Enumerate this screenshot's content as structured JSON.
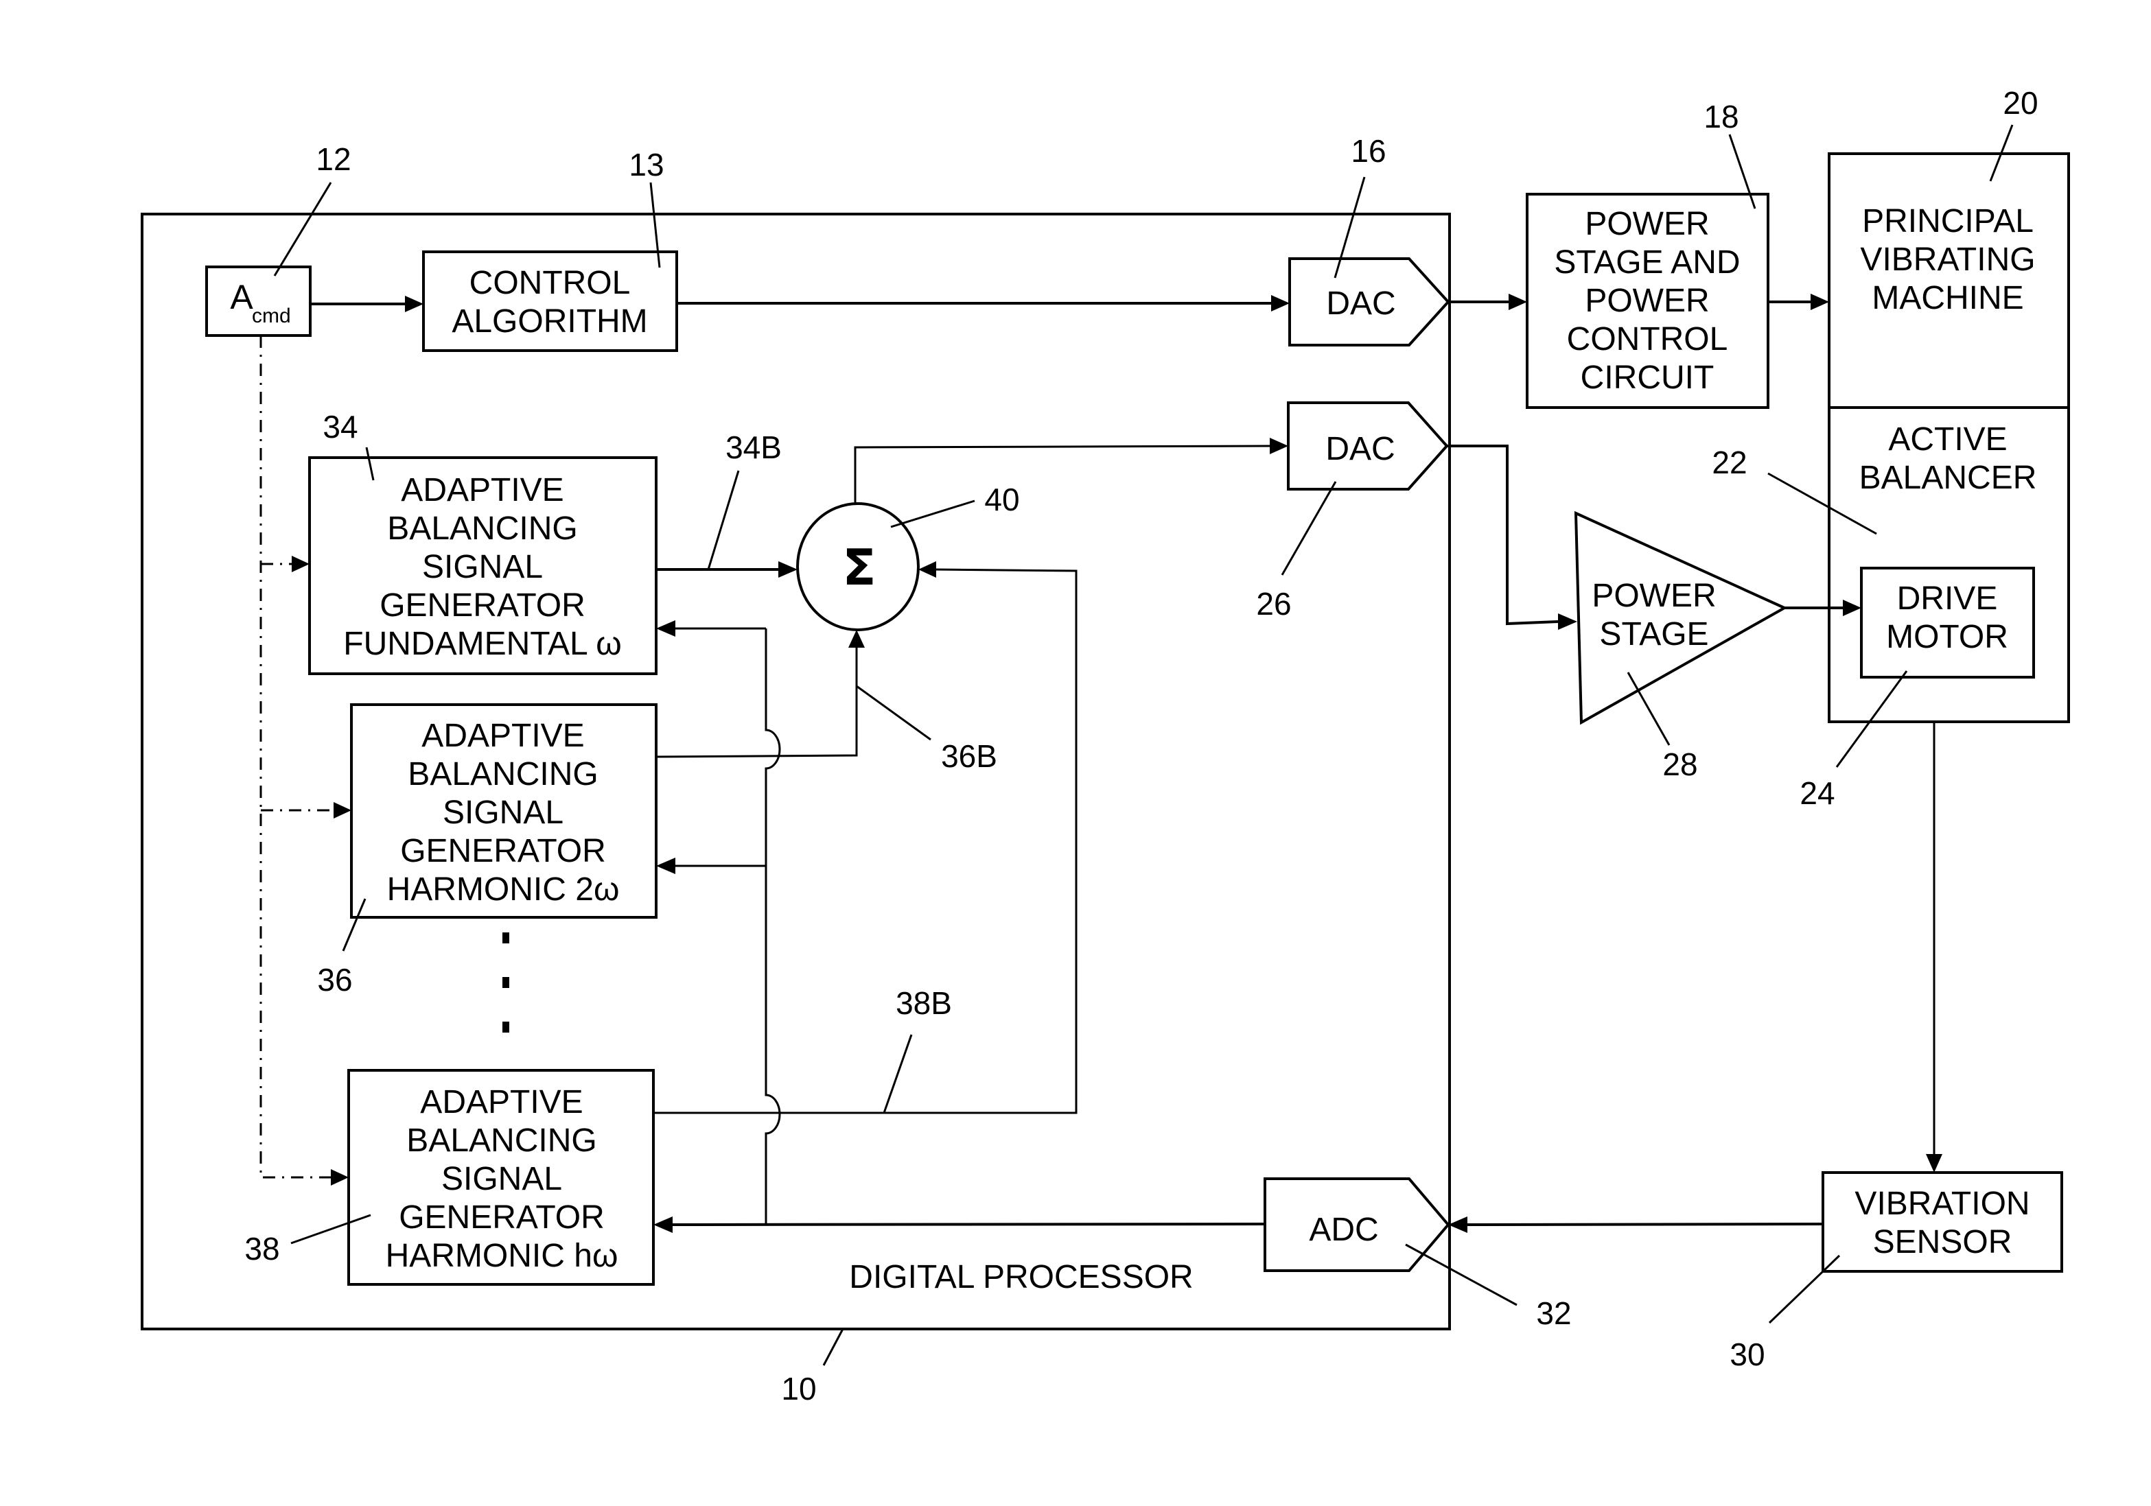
{
  "diagram": {
    "blocks": {
      "digital_processor": {
        "label": "DIGITAL PROCESSOR",
        "ref": "10"
      },
      "acmd": {
        "label_main": "A",
        "label_sub": "cmd",
        "ref": "12"
      },
      "control_algorithm": {
        "lines": [
          "CONTROL",
          "ALGORITHM"
        ],
        "ref": "13"
      },
      "dac_16": {
        "label": "DAC",
        "ref": "16"
      },
      "power_stage_control": {
        "lines": [
          "POWER",
          "STAGE AND",
          "POWER",
          "CONTROL",
          "CIRCUIT"
        ],
        "ref": "18"
      },
      "principal_machine": {
        "lines": [
          "PRINCIPAL",
          "VIBRATING",
          "MACHINE"
        ],
        "ref": "20"
      },
      "active_balancer": {
        "lines": [
          "ACTIVE",
          "BALANCER"
        ],
        "ref": "22"
      },
      "drive_motor": {
        "lines": [
          "DRIVE",
          "MOTOR"
        ],
        "ref": "24"
      },
      "dac_26": {
        "label": "DAC",
        "ref": "26"
      },
      "power_stage": {
        "lines": [
          "POWER",
          "STAGE"
        ],
        "ref": "28"
      },
      "vibration_sensor": {
        "lines": [
          "VIBRATION",
          "SENSOR"
        ],
        "ref": "30"
      },
      "adc": {
        "label": "ADC",
        "ref": "32"
      },
      "gen_fundamental": {
        "lines": [
          "ADAPTIVE",
          "BALANCING",
          "SIGNAL",
          "GENERATOR",
          "FUNDAMENTAL ω"
        ],
        "ref": "34",
        "output_ref": "34B"
      },
      "gen_harmonic_2": {
        "lines": [
          "ADAPTIVE",
          "BALANCING",
          "SIGNAL",
          "GENERATOR",
          "HARMONIC 2ω"
        ],
        "ref": "36",
        "output_ref": "36B"
      },
      "gen_harmonic_h": {
        "lines": [
          "ADAPTIVE",
          "BALANCING",
          "SIGNAL",
          "GENERATOR",
          "HARMONIC hω"
        ],
        "ref": "38",
        "output_ref": "38B"
      },
      "summer": {
        "symbol": "Σ",
        "ref": "40"
      }
    }
  }
}
